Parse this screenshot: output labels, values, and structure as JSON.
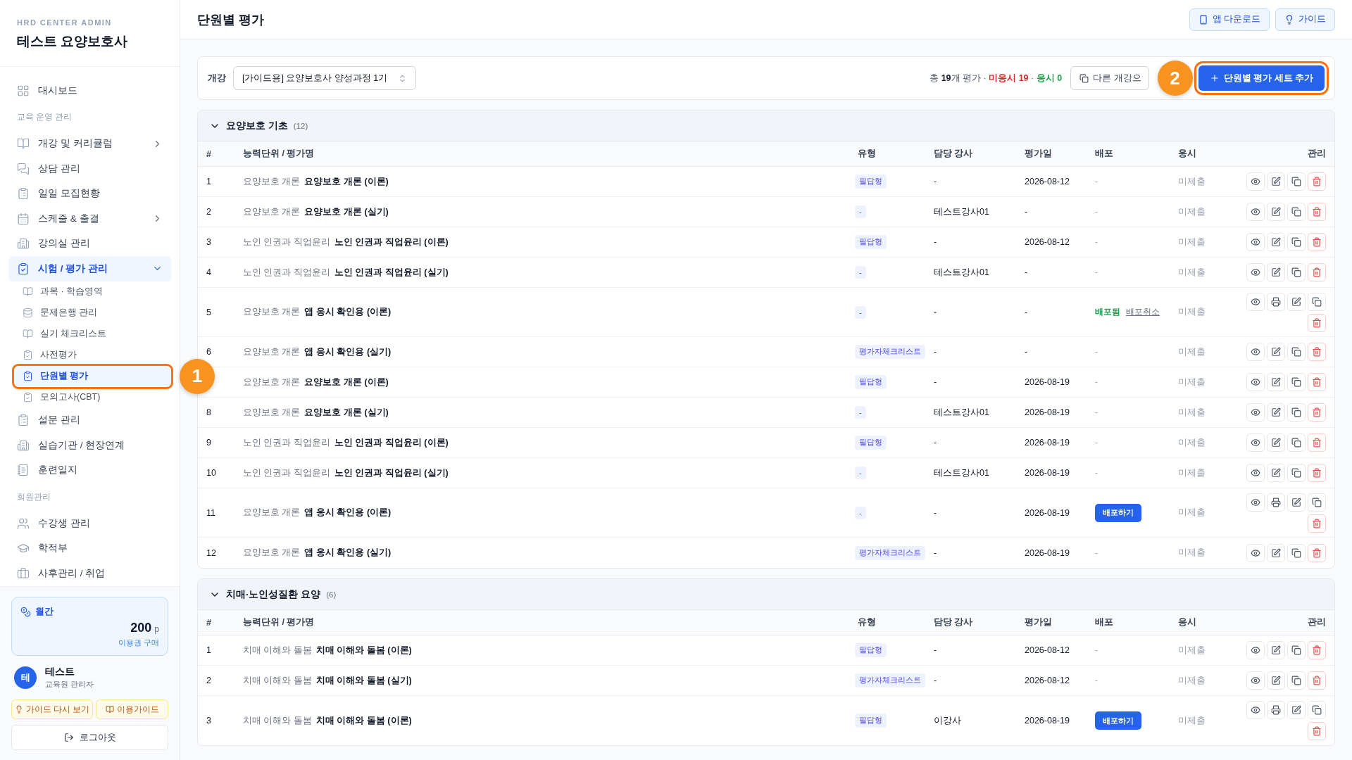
{
  "sidebar": {
    "brand_label": "HRD CENTER ADMIN",
    "brand_title": "테스트 요양보호사",
    "nav": [
      {
        "kind": "item",
        "label": "대시보드",
        "selected": false
      },
      {
        "kind": "section",
        "label": "교육 운영 관리"
      },
      {
        "kind": "item",
        "label": "개강 및 커리큘럼",
        "selected": false,
        "expanded": false
      },
      {
        "kind": "item",
        "label": "상담 관리",
        "selected": false
      },
      {
        "kind": "item",
        "label": "일일 모집현황",
        "selected": false
      },
      {
        "kind": "item",
        "label": "스케줄 & 출결",
        "selected": false,
        "expanded": false
      },
      {
        "kind": "item",
        "label": "강의실 관리",
        "selected": false
      },
      {
        "kind": "item",
        "label": "시험 / 평가 관리",
        "selected": true,
        "expanded": true,
        "children": [
          {
            "label": "과목 · 학습영역",
            "selected": false
          },
          {
            "label": "문제은행 관리",
            "selected": false
          },
          {
            "label": "실기 체크리스트",
            "selected": false
          },
          {
            "label": "사전평가",
            "selected": false
          },
          {
            "label": "단원별 평가",
            "selected": true,
            "highlighted": true,
            "callout": "1"
          },
          {
            "label": "모의고사(CBT)",
            "selected": false
          }
        ]
      },
      {
        "kind": "item",
        "label": "설문 관리",
        "selected": false
      },
      {
        "kind": "item",
        "label": "실습기관 / 현장연계",
        "selected": false
      },
      {
        "kind": "item",
        "label": "훈련일지",
        "selected": false
      },
      {
        "kind": "section",
        "label": "회원관리"
      },
      {
        "kind": "item",
        "label": "수강생 관리",
        "selected": false
      },
      {
        "kind": "item",
        "label": "학적부",
        "selected": false
      },
      {
        "kind": "item",
        "label": "사후관리 / 취업",
        "selected": false
      }
    ],
    "plan": {
      "label": "월간",
      "points": "200",
      "unit": "p",
      "link": "이용권 구매"
    },
    "user": {
      "avatar": "테",
      "name": "테스트",
      "role": "교육원 관리자"
    },
    "buttons": [
      "가이드 다시 보기",
      "이용가이드"
    ],
    "logout": "로그아웃"
  },
  "header": {
    "title": "단원별 평가",
    "buttons": [
      "앱 다운로드",
      "가이드"
    ]
  },
  "filter": {
    "label": "개강",
    "course": "[가이드용] 요양보호사 양성과정 1기",
    "summary": [
      {
        "kind": "plain",
        "text": "총 "
      },
      {
        "kind": "strong",
        "text": "19"
      },
      {
        "kind": "plain",
        "text": "개 평가 · "
      },
      {
        "kind": "danger",
        "text": "미응시 19"
      },
      {
        "kind": "plain",
        "text": " · "
      },
      {
        "kind": "success",
        "text": "응시 0"
      }
    ],
    "copy_button": "다른 개강으",
    "add_button": {
      "label": "단원별 평가 세트 추가",
      "highlighted": true,
      "callout": "2"
    }
  },
  "sections": [
    {
      "title": "요양보호 기초",
      "count": "(12)",
      "expanded": true,
      "columns": [
        "#",
        "능력단위 / 평가명",
        "유형",
        "담당 강사",
        "평가일",
        "배포",
        "응시",
        "관리"
      ],
      "rows": [
        {
          "no": "1",
          "unit": "요양보호 개론",
          "name": "요양보호 개론 (이론)",
          "type": "필답형",
          "teacher": "-",
          "date": "2026-08-12",
          "distribution": {
            "kind": "none",
            "text": "-"
          },
          "submission": "미제출",
          "printable": false
        },
        {
          "no": "2",
          "unit": "요양보호 개론",
          "name": "요양보호 개론 (실기)",
          "type": "-",
          "teacher": "테스트강사01",
          "date": "-",
          "distribution": {
            "kind": "none",
            "text": "-"
          },
          "submission": "미제출",
          "printable": false
        },
        {
          "no": "3",
          "unit": "노인 인권과 직업윤리",
          "name": "노인 인권과 직업윤리 (이론)",
          "type": "필답형",
          "teacher": "-",
          "date": "2026-08-12",
          "distribution": {
            "kind": "none",
            "text": "-"
          },
          "submission": "미제출",
          "printable": false
        },
        {
          "no": "4",
          "unit": "노인 인권과 직업윤리",
          "name": "노인 인권과 직업윤리 (실기)",
          "type": "-",
          "teacher": "테스트강사01",
          "date": "-",
          "distribution": {
            "kind": "none",
            "text": "-"
          },
          "submission": "미제출",
          "printable": false
        },
        {
          "no": "5",
          "unit": "요양보호 개론",
          "name": "앱 응시 확인용 (이론)",
          "type": "-",
          "teacher": "-",
          "date": "-",
          "distribution": {
            "kind": "distributed",
            "status": "배포됨",
            "action": "배포취소"
          },
          "submission": "미제출",
          "printable": true
        },
        {
          "no": "6",
          "unit": "요양보호 개론",
          "name": "앱 응시 확인용 (실기)",
          "type": "평가자체크리스트",
          "teacher": "-",
          "date": "-",
          "distribution": {
            "kind": "none",
            "text": "-"
          },
          "submission": "미제출",
          "printable": false
        },
        {
          "unit": "요양보호 개론",
          "name": "요양보호 개론 (이론)",
          "type": "필답형",
          "teacher": "-",
          "date": "2026-08-19",
          "distribution": {
            "kind": "none",
            "text": "-"
          },
          "submission": "미제출",
          "printable": false
        },
        {
          "no": "8",
          "unit": "요양보호 개론",
          "name": "요양보호 개론 (실기)",
          "type": "-",
          "teacher": "테스트강사01",
          "date": "2026-08-19",
          "distribution": {
            "kind": "none",
            "text": "-"
          },
          "submission": "미제출",
          "printable": false
        },
        {
          "no": "9",
          "unit": "노인 인권과 직업윤리",
          "name": "노인 인권과 직업윤리 (이론)",
          "type": "필답형",
          "teacher": "-",
          "date": "2026-08-19",
          "distribution": {
            "kind": "none",
            "text": "-"
          },
          "submission": "미제출",
          "printable": false
        },
        {
          "no": "10",
          "unit": "노인 인권과 직업윤리",
          "name": "노인 인권과 직업윤리 (실기)",
          "type": "-",
          "teacher": "테스트강사01",
          "date": "2026-08-19",
          "distribution": {
            "kind": "none",
            "text": "-"
          },
          "submission": "미제출",
          "printable": false
        },
        {
          "no": "11",
          "unit": "요양보호 개론",
          "name": "앱 응시 확인용 (이론)",
          "type": "-",
          "teacher": "-",
          "date": "2026-08-19",
          "distribution": {
            "kind": "button",
            "label": "배포하기"
          },
          "submission": "미제출",
          "printable": true
        },
        {
          "no": "12",
          "unit": "요양보호 개론",
          "name": "앱 응시 확인용 (실기)",
          "type": "평가자체크리스트",
          "teacher": "-",
          "date": "2026-08-19",
          "distribution": {
            "kind": "none",
            "text": "-"
          },
          "submission": "미제출",
          "printable": false
        }
      ]
    },
    {
      "title": "치매·노인성질환 요양",
      "count": "(6)",
      "expanded": true,
      "columns": [
        "#",
        "능력단위 / 평가명",
        "유형",
        "담당 강사",
        "평가일",
        "배포",
        "응시",
        "관리"
      ],
      "rows": [
        {
          "no": "1",
          "unit": "치매 이해와 돌봄",
          "name": "치매 이해와 돌봄 (이론)",
          "type": "필답형",
          "teacher": "-",
          "date": "2026-08-12",
          "distribution": {
            "kind": "none",
            "text": "-"
          },
          "submission": "미제출",
          "printable": false
        },
        {
          "no": "2",
          "unit": "치매 이해와 돌봄",
          "name": "치매 이해와 돌봄 (실기)",
          "type": "평가자체크리스트",
          "teacher": "-",
          "date": "2026-08-12",
          "distribution": {
            "kind": "none",
            "text": "-"
          },
          "submission": "미제출",
          "printable": false
        },
        {
          "no": "3",
          "unit": "치매 이해와 돌봄",
          "name": "치매 이해와 돌봄 (이론)",
          "type": "필답형",
          "teacher": "이강사",
          "date": "2026-08-19",
          "distribution": {
            "kind": "button",
            "label": "배포하기"
          },
          "submission": "미제출",
          "printable": true
        }
      ]
    }
  ]
}
